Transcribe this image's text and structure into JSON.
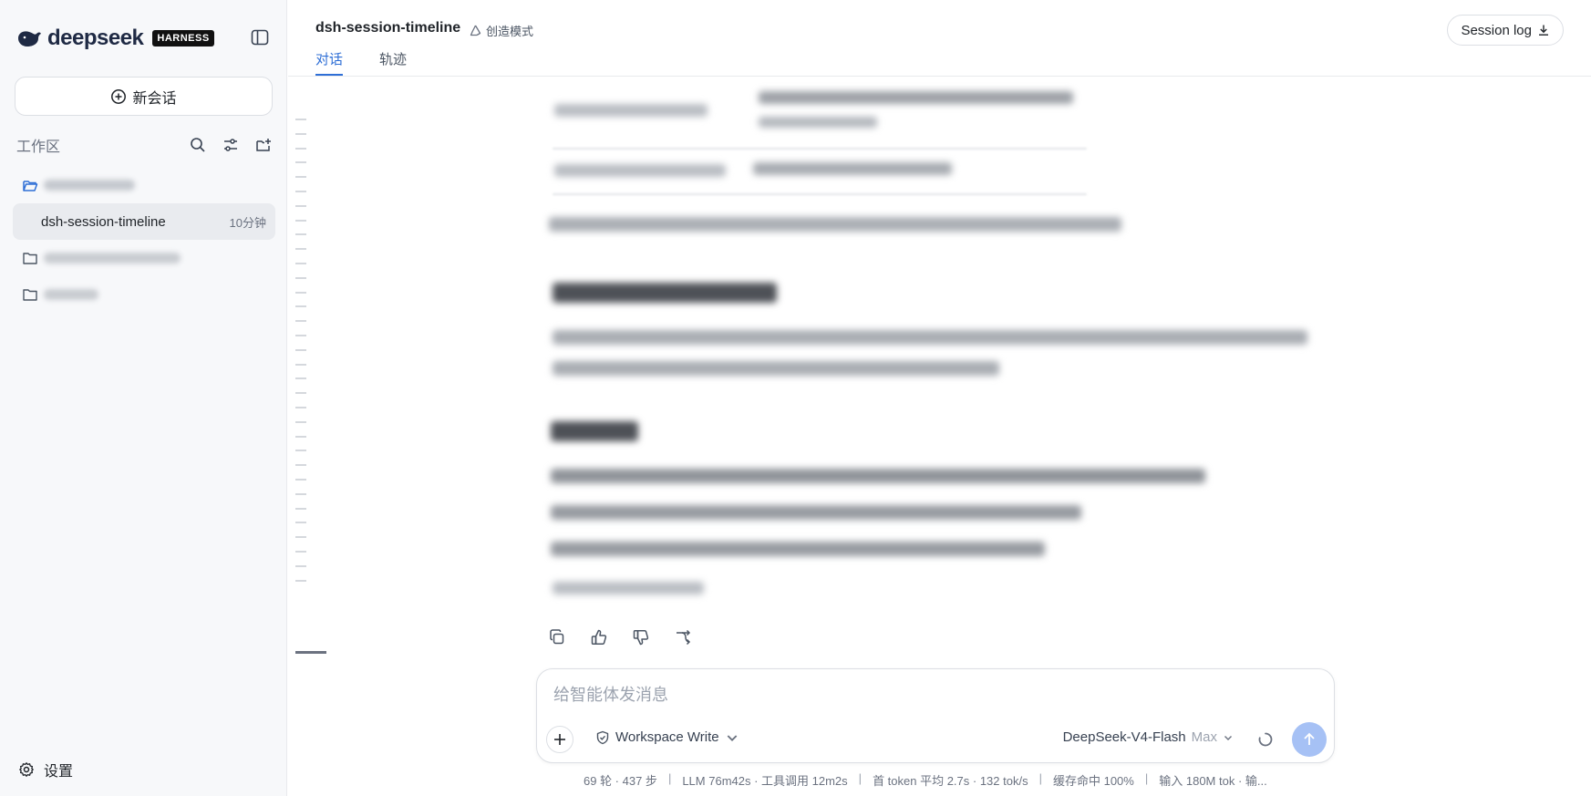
{
  "brand": {
    "name": "deepseek",
    "tag": "HARNESS"
  },
  "sidebar": {
    "new_chat": "新会话",
    "workspace_label": "工作区",
    "session": {
      "name": "dsh-session-timeline",
      "time": "10分钟"
    },
    "settings": "设置"
  },
  "header": {
    "session_title": "dsh-session-timeline",
    "mode": "创造模式",
    "tabs": [
      "对话",
      "轨迹"
    ],
    "session_log": "Session log"
  },
  "composer": {
    "placeholder": "给智能体发消息",
    "permission": "Workspace Write",
    "model": "DeepSeek-V4-Flash",
    "effort": "Max"
  },
  "status": {
    "rounds": "69 轮 · 437 步",
    "llm": "LLM 76m42s · 工具调用 12m2s",
    "token": "首 token 平均 2.7s · 132 tok/s",
    "cache": "缓存命中 100%",
    "input": "输入 180M tok · 输..."
  },
  "colors": {
    "accent": "#2f6fd6",
    "send": "#a6c1f5",
    "sidebar_bg": "#f7f8fa"
  }
}
